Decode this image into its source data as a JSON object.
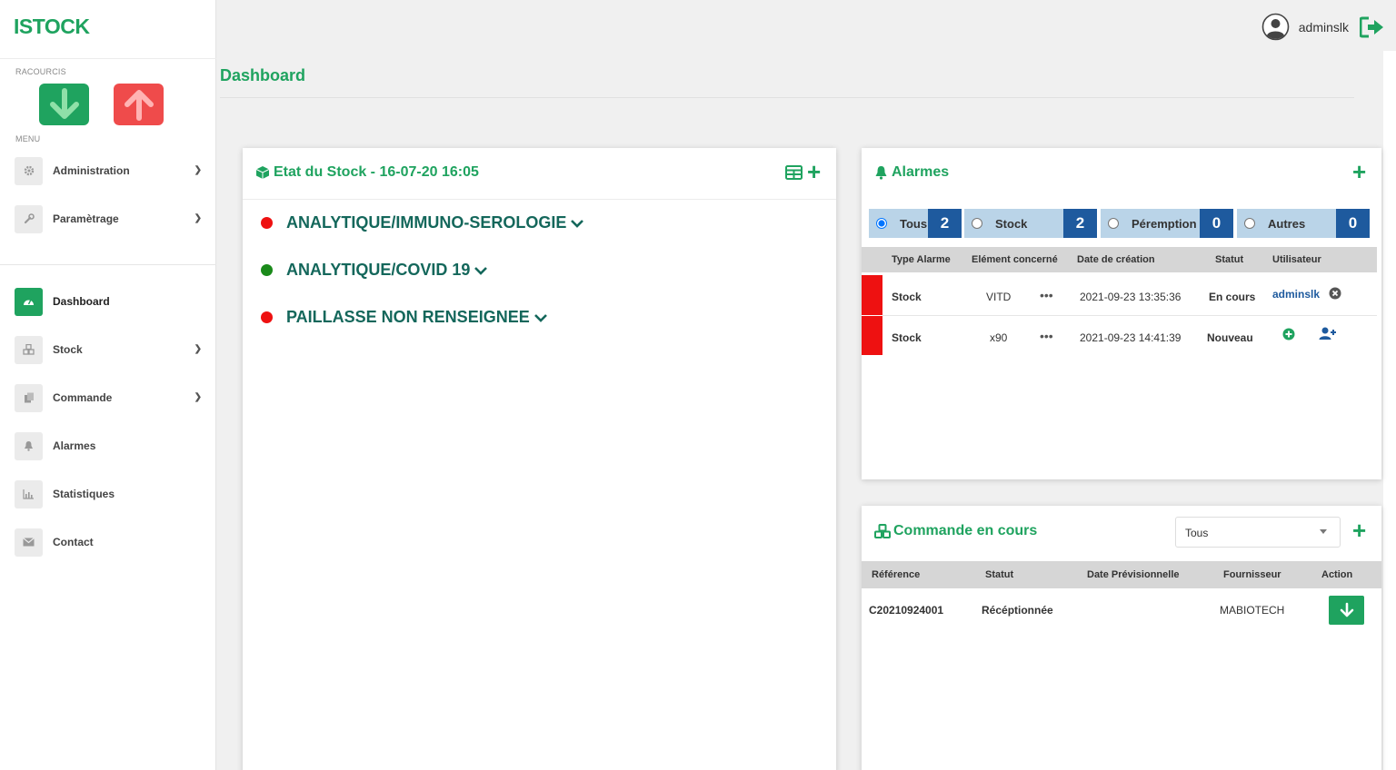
{
  "app": {
    "logo": "ISTOCK"
  },
  "sidebar": {
    "shortcuts_label": "RACOURCIS",
    "menu_label": "MENU",
    "items": [
      {
        "label": "Administration",
        "icon": "gear-icon"
      },
      {
        "label": "Paramètrage",
        "icon": "wrench-icon"
      },
      {
        "label": "Dashboard",
        "icon": "dashboard-icon"
      },
      {
        "label": "Stock",
        "icon": "cubes-icon"
      },
      {
        "label": "Commande",
        "icon": "copy-icon"
      },
      {
        "label": "Alarmes",
        "icon": "bell-icon"
      },
      {
        "label": "Statistiques",
        "icon": "bar-chart-icon"
      },
      {
        "label": "Contact",
        "icon": "envelope-icon"
      }
    ]
  },
  "header": {
    "username": "adminslk",
    "page_title": "Dashboard"
  },
  "stock_panel": {
    "title": "Etat du Stock - 16-07-20 16:05",
    "rows": [
      {
        "label": "ANALYTIQUE/IMMUNO-SEROLOGIE",
        "status_color": "#ee1111"
      },
      {
        "label": "ANALYTIQUE/COVID 19",
        "status_color": "#1a8a1a"
      },
      {
        "label": "PAILLASSE NON RENSEIGNEE",
        "status_color": "#ee1111"
      }
    ]
  },
  "alarms_panel": {
    "title": "Alarmes",
    "tabs": [
      {
        "label": "Tous",
        "count": "2",
        "selected": true
      },
      {
        "label": "Stock",
        "count": "2",
        "selected": false
      },
      {
        "label": "Péremption",
        "count": "0",
        "selected": false
      },
      {
        "label": "Autres",
        "count": "0",
        "selected": false
      }
    ],
    "columns": [
      "Type Alarme",
      "Elément concerné",
      "Date de création",
      "Statut",
      "Utilisateur"
    ],
    "rows": [
      {
        "type": "Stock",
        "element": "VITD",
        "more": "•••",
        "date": "2021-09-23 13:35:36",
        "status": "En cours",
        "user": "adminslk"
      },
      {
        "type": "Stock",
        "element": "x90",
        "more": "•••",
        "date": "2021-09-23 14:41:39",
        "status": "Nouveau",
        "user": ""
      }
    ]
  },
  "orders_panel": {
    "title": "Commande en cours",
    "filter_value": "Tous",
    "columns": [
      "Référence",
      "Statut",
      "Date Prévisionnelle",
      "Fournisseur",
      "Action"
    ],
    "rows": [
      {
        "reference": "C20210924001",
        "status": "Récéptionnée",
        "date": "",
        "supplier": "MABIOTECH"
      }
    ]
  },
  "colors": {
    "accent": "#1fa35f",
    "danger": "#ef4b4b",
    "alarm_row": "#ee1111",
    "tab_bg": "#bad4e8",
    "tab_count_bg": "#1e5a9e",
    "stock_label": "#14675b"
  }
}
